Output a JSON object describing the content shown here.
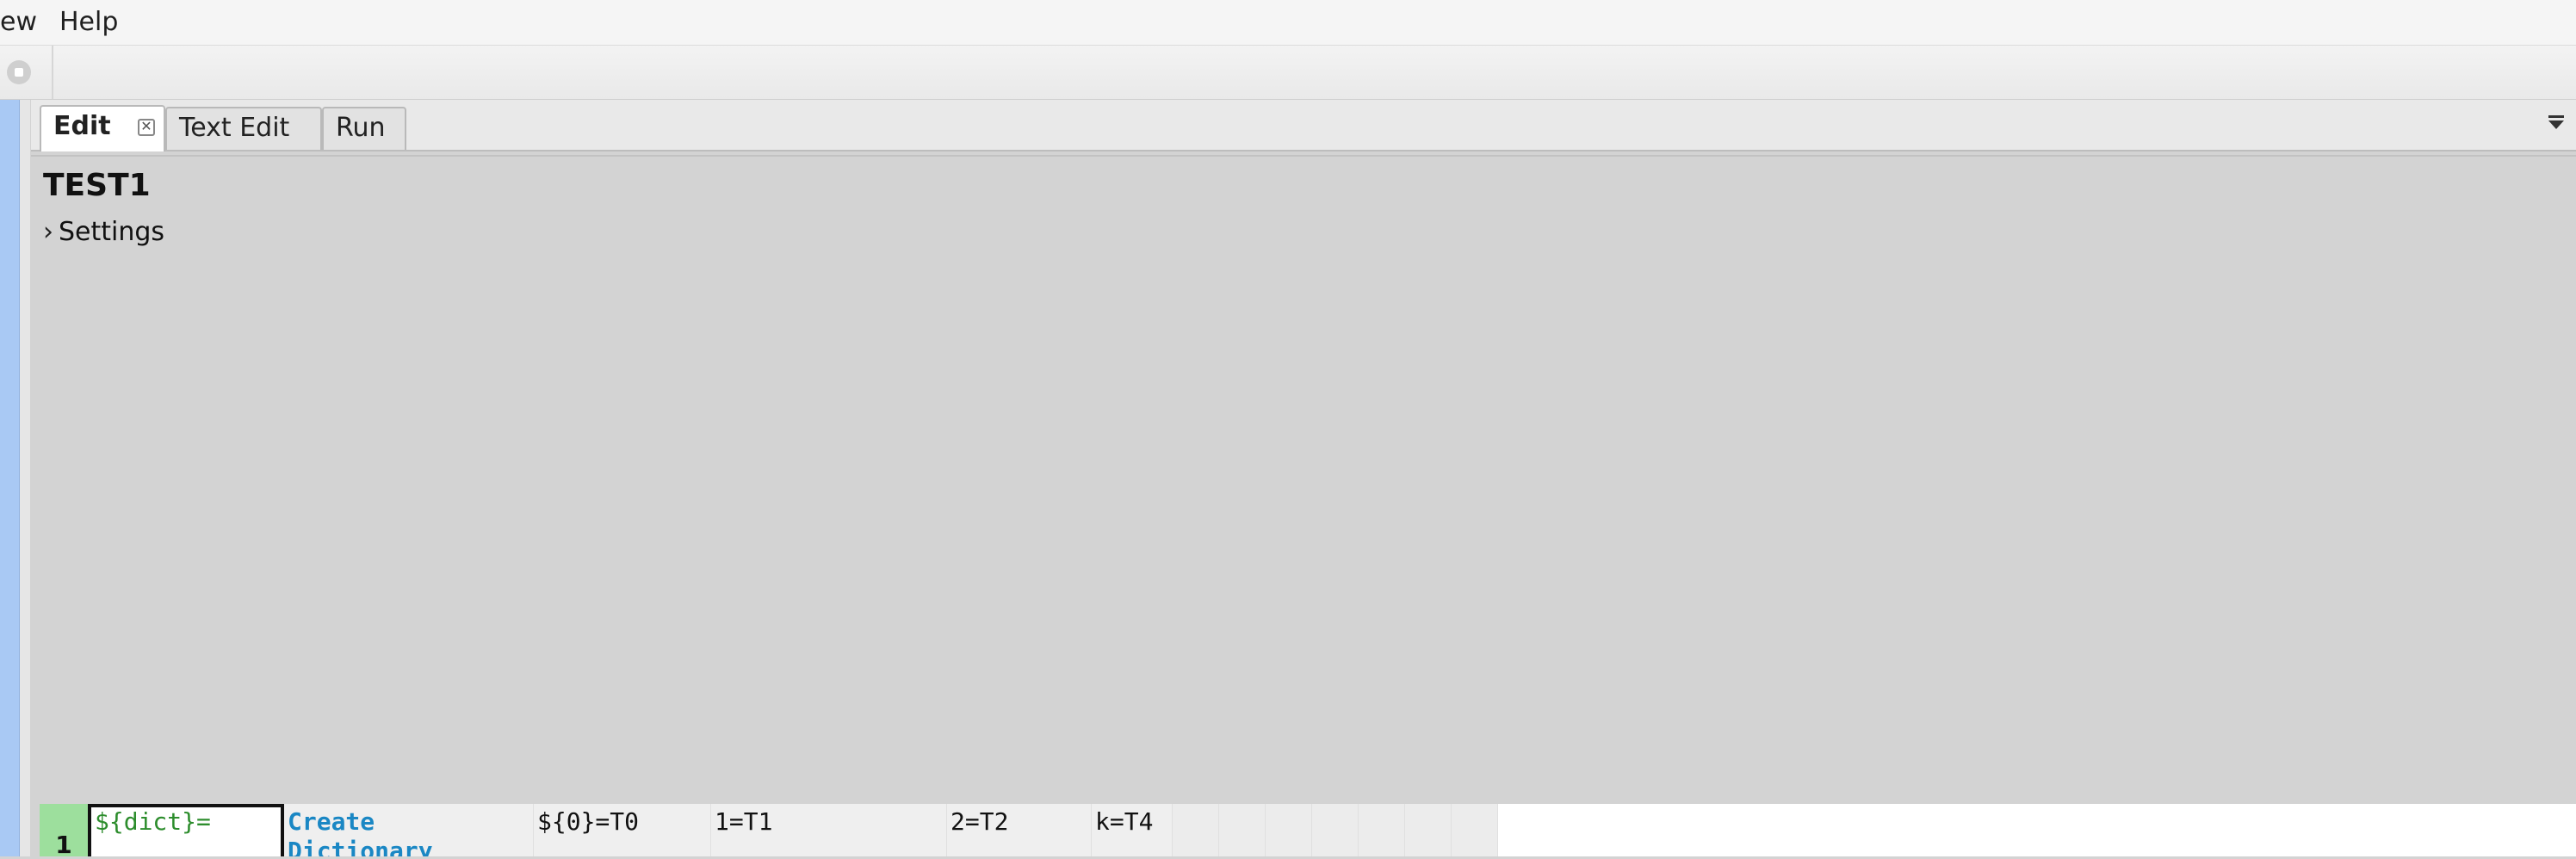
{
  "menubar": {
    "items": [
      "ew",
      "Help"
    ]
  },
  "tabs": [
    {
      "label": "Edit",
      "active": true,
      "closable": true
    },
    {
      "label": "Text Edit",
      "active": false
    },
    {
      "label": "Run",
      "active": false
    }
  ],
  "editor": {
    "title": "TEST1",
    "settings_label": "Settings",
    "settings_collapsed_icon": "chevron-right-icon"
  },
  "table": {
    "rows": [
      {
        "number": "1",
        "cells": [
          "${dict}=",
          "Create\nDictionary",
          "${0}=T0",
          "1=T1",
          "2=T2",
          "k=T4"
        ]
      }
    ]
  },
  "colors": {
    "assign_variable": "#2d8d2d",
    "keyword": "#1a87c4",
    "row_number_bg": "#9ddf9d",
    "editor_bg": "#d3d3d3",
    "left_strip": "#a9c9f4"
  }
}
